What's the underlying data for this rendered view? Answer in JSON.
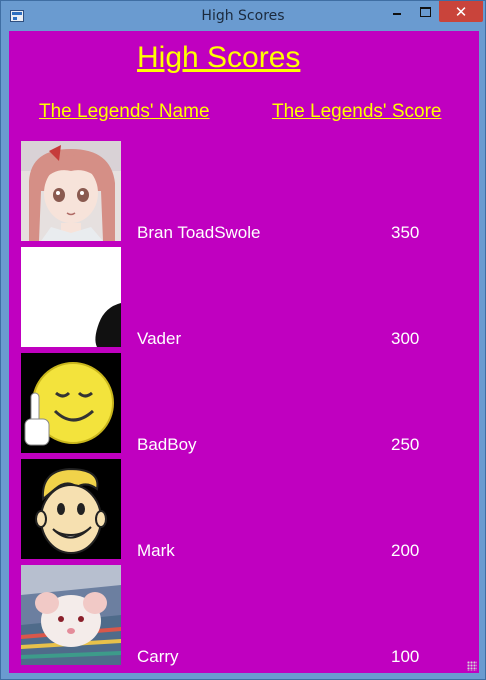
{
  "window": {
    "title": "High Scores",
    "close_glyph": "✕"
  },
  "heading": "High Scores",
  "columns": {
    "name": "The Legends' Name",
    "score": "The Legends' Score"
  },
  "rows": [
    {
      "name": "Bran ToadSwole",
      "score": "350",
      "avatar": "anime-girl-avatar"
    },
    {
      "name": "Vader",
      "score": "300",
      "avatar": "white-avatar"
    },
    {
      "name": "BadBoy",
      "score": "250",
      "avatar": "smiley-avatar"
    },
    {
      "name": "Mark",
      "score": "200",
      "avatar": "vault-boy-avatar"
    },
    {
      "name": "Carry",
      "score": "100",
      "avatar": "rat-avatar"
    }
  ],
  "colors": {
    "client_bg": "#c000c0",
    "header_text": "#ffff00",
    "row_text": "#ffffff",
    "titlebar": "#6a9bd0",
    "close_button": "#c9443b"
  }
}
